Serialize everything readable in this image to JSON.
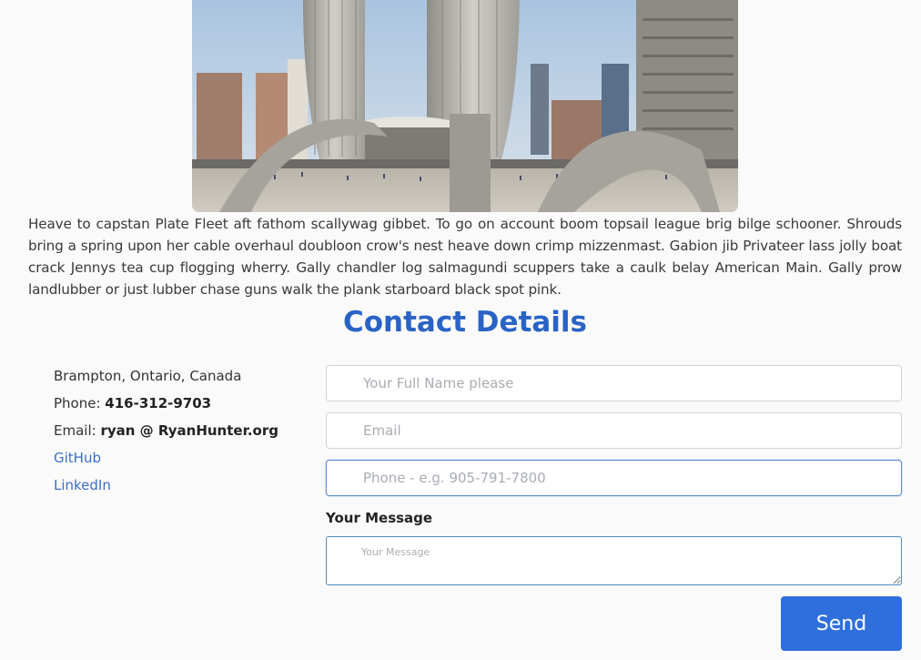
{
  "hero": {
    "alt": "Toronto City Hall and Nathan Phillips Square"
  },
  "intro": {
    "text": "Heave to capstan Plate Fleet aft fathom scallywag gibbet. To go on account boom topsail league brig bilge schooner. Shrouds bring a spring upon her cable overhaul doubloon crow's nest heave down crimp mizzenmast. Gabion jib Privateer lass jolly boat crack Jennys tea cup flogging wherry. Gally chandler log salmagundi scuppers take a caulk belay American Main. Gally prow landlubber or just lubber chase guns walk the plank starboard black spot pink."
  },
  "contact": {
    "title": "Contact Details",
    "location": "Brampton, Ontario, Canada",
    "phone_label": "Phone: ",
    "phone_value": "416-312-9703",
    "email_label": "Email: ",
    "email_value": "ryan @ RyanHunter.org",
    "github_label": "GitHub",
    "linkedin_label": "LinkedIn"
  },
  "form": {
    "name_placeholder": "Your Full Name please",
    "email_placeholder": "Email",
    "phone_placeholder": "Phone - e.g. 905-791-7800",
    "message_label": "Your Message",
    "message_placeholder": "Your Message",
    "send_label": "Send"
  },
  "colors": {
    "accent": "#2a63c6",
    "button": "#2f6fdc",
    "link": "#3a6fc4"
  }
}
